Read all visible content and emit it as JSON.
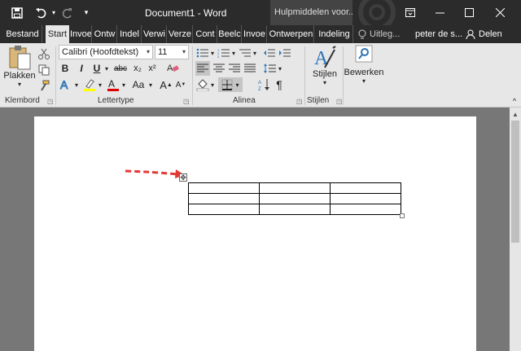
{
  "titlebar": {
    "title": "Document1 - Word",
    "context_tab": "Hulpmiddelen voor..."
  },
  "tabs": [
    {
      "label": "Bestand"
    },
    {
      "label": "Start"
    },
    {
      "label": "Invoe"
    },
    {
      "label": "Ontw"
    },
    {
      "label": "Indel"
    },
    {
      "label": "Verwi"
    },
    {
      "label": "Verze"
    },
    {
      "label": "Cont"
    },
    {
      "label": "Beelc"
    },
    {
      "label": "Invoe"
    },
    {
      "label": "Ontwerpen"
    },
    {
      "label": "Indeling"
    }
  ],
  "tell_me": "Uitleg...",
  "user": "peter de s...",
  "share": "Delen",
  "ribbon": {
    "paste_label": "Plakken",
    "font_name": "Calibri (Hoofdtekst)",
    "font_size": "11",
    "bold": "B",
    "italic": "I",
    "underline": "U",
    "strike": "abc",
    "subscript": "x₂",
    "superscript": "x²",
    "change_case": "Aa",
    "grow_font": "A",
    "shrink_font": "A",
    "pilcrow": "¶",
    "styles_label": "Stijlen",
    "edit_label": "Bewerken",
    "groups": {
      "clipboard": "Klembord",
      "font": "Lettertype",
      "paragraph": "Alinea",
      "styles": "Stijlen"
    }
  },
  "table": {
    "rows": 3,
    "cols": 3
  },
  "colors": {
    "titlebar": "#2b2b2b",
    "ribbon": "#e7e7e7",
    "highlight": "#ffff00",
    "font_color": "#e00000",
    "arrow": "#e53935"
  }
}
